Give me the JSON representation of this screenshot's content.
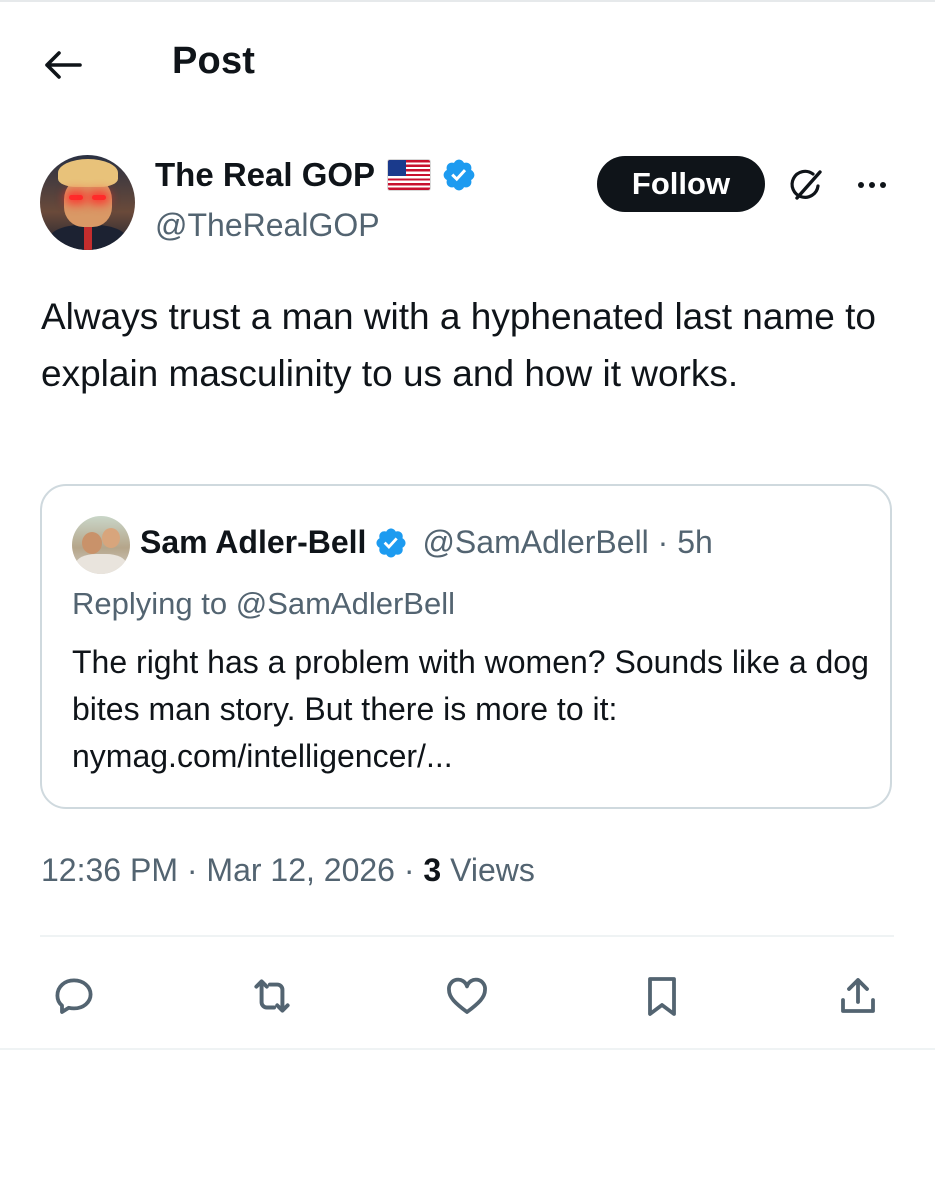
{
  "header": {
    "title": "Post",
    "back_icon": "arrow-left-icon"
  },
  "post": {
    "author": {
      "name": "The Real GOP",
      "flag": "us-flag-emoji",
      "verified": true,
      "handle": "@TheRealGOP"
    },
    "follow_label": "Follow",
    "text": "Always trust a man with a hyphenated last name to explain masculinity to us and how it works.",
    "quote": {
      "author_name": "Sam Adler-Bell",
      "verified": true,
      "handle_time": "@SamAdlerBell · 5h",
      "replying_prefix": "Replying to ",
      "replying_handle": "@SamAdlerBell",
      "text": "The right has a problem with women? Sounds like a dog bites man story. But there is more to it: nymag.com/intelligencer/..."
    },
    "meta": {
      "time_date": "12:36 PM · Mar 12, 2026 · ",
      "views_count": "3",
      "views_label": " Views"
    }
  },
  "actions": [
    "reply-icon",
    "retweet-icon",
    "like-icon",
    "bookmark-icon",
    "share-icon"
  ],
  "colors": {
    "text": "#0f1419",
    "secondary": "#536471",
    "verified_blue": "#1d9bf0",
    "border": "#cfd9de",
    "button": "#0f1419"
  }
}
